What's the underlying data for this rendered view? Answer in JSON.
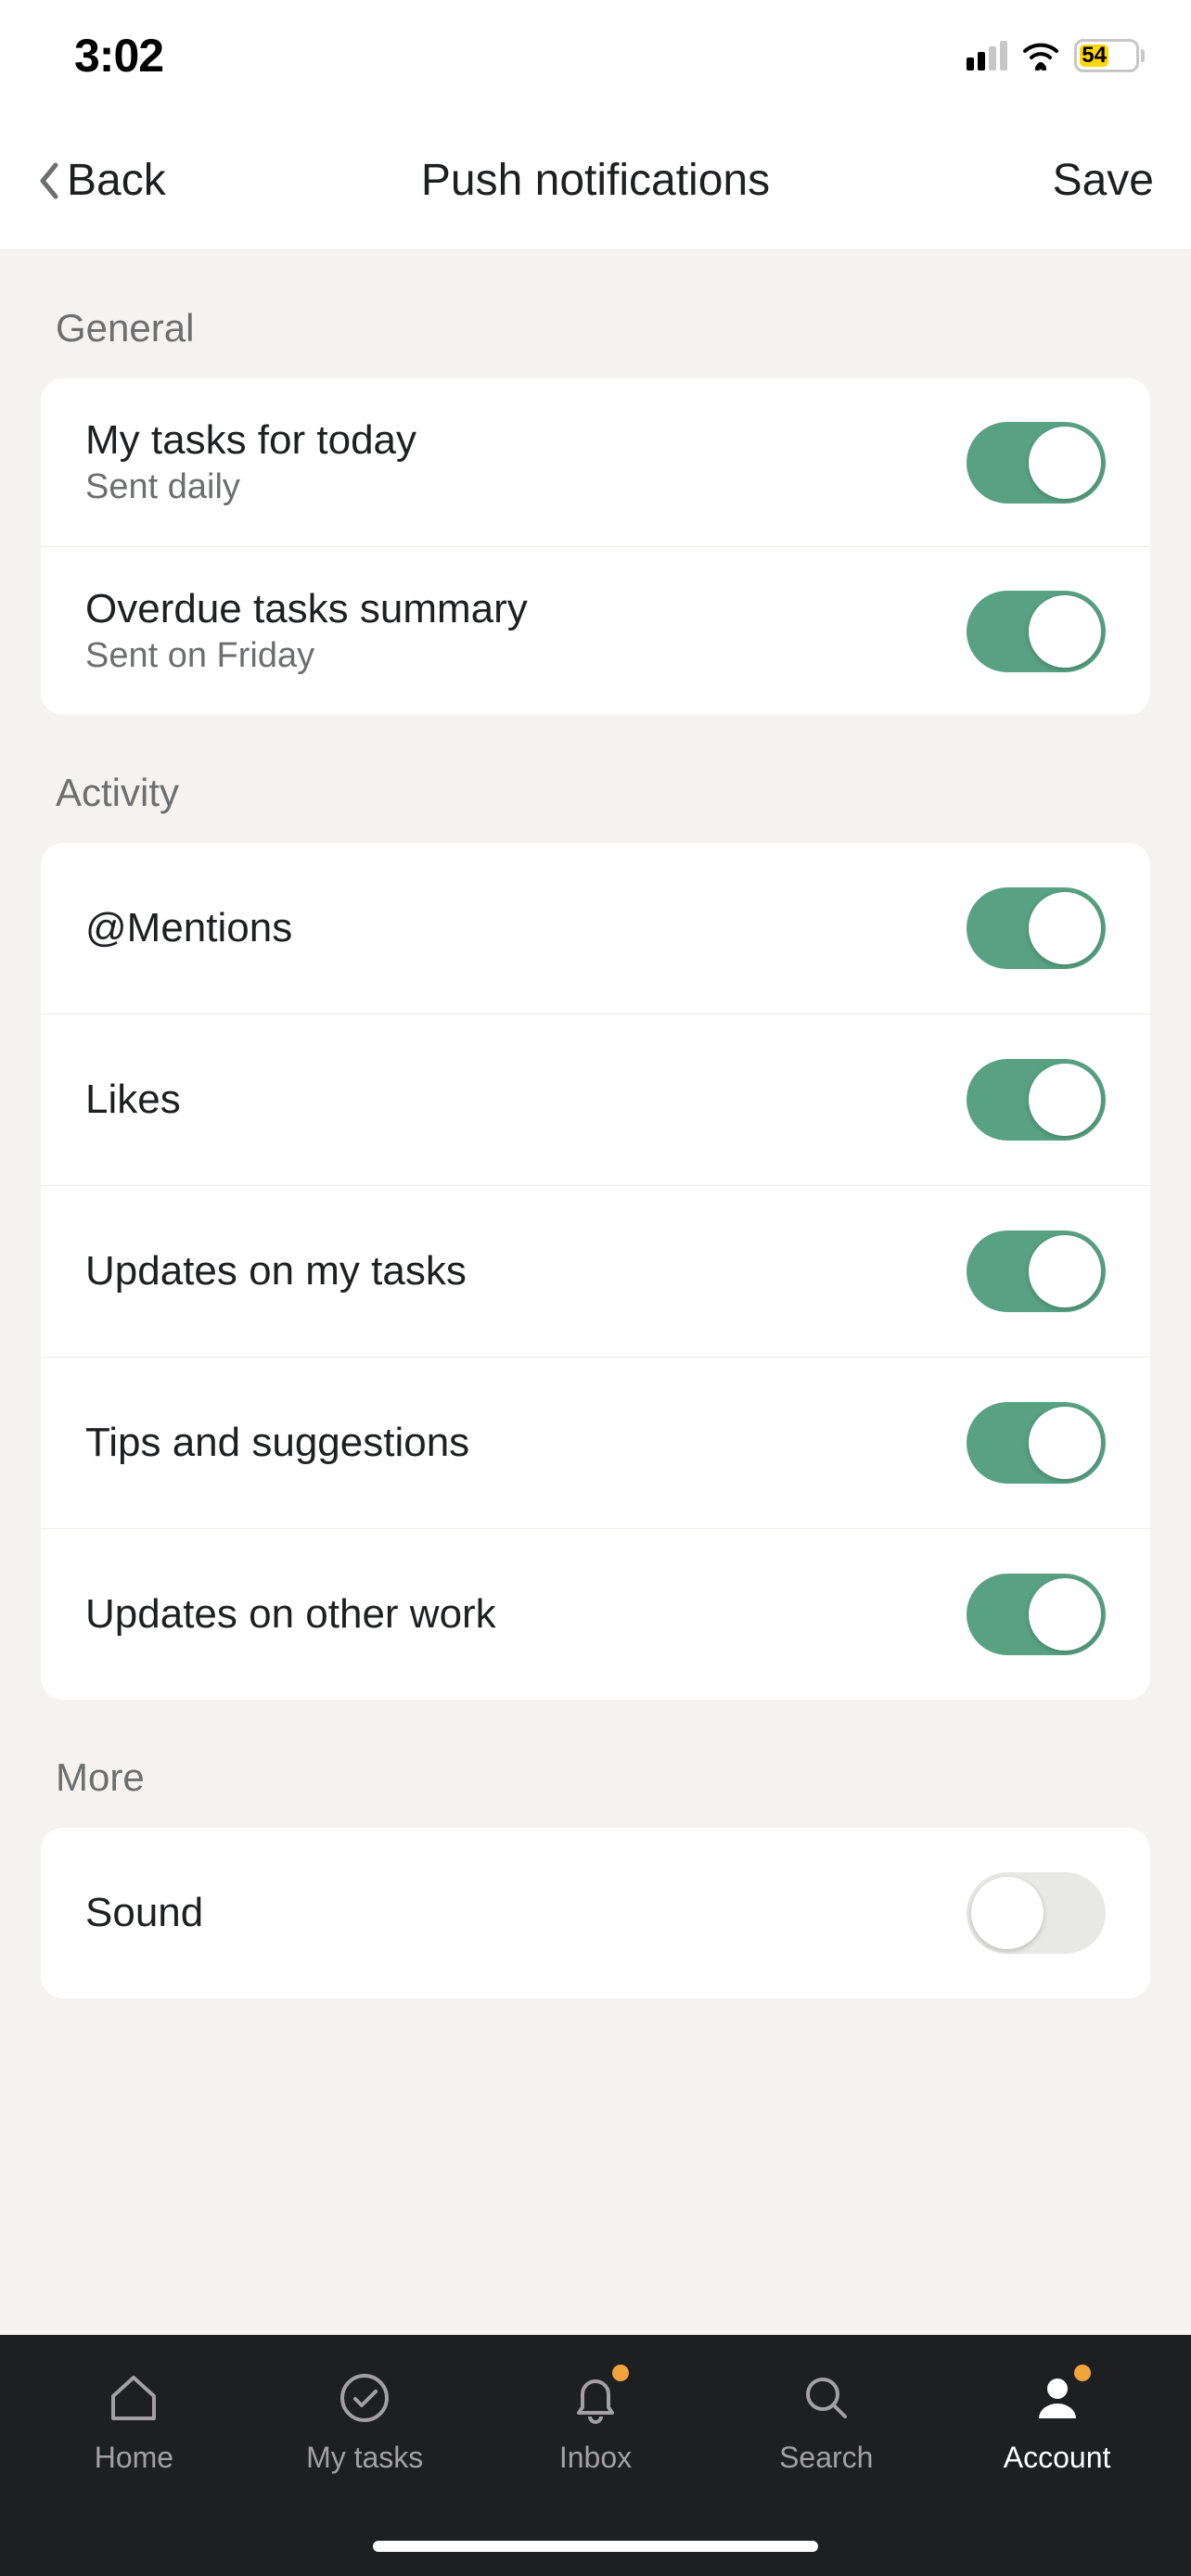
{
  "status": {
    "time": "3:02",
    "battery_pct": "54"
  },
  "nav": {
    "back": "Back",
    "title": "Push notifications",
    "save": "Save"
  },
  "sections": {
    "general": {
      "header": "General",
      "items": [
        {
          "title": "My tasks for today",
          "sub": "Sent daily",
          "on": true
        },
        {
          "title": "Overdue tasks summary",
          "sub": "Sent on Friday",
          "on": true
        }
      ]
    },
    "activity": {
      "header": "Activity",
      "items": [
        {
          "title": "@Mentions",
          "on": true
        },
        {
          "title": "Likes",
          "on": true
        },
        {
          "title": "Updates on my tasks",
          "on": true
        },
        {
          "title": "Tips and suggestions",
          "on": true
        },
        {
          "title": "Updates on other work",
          "on": true
        }
      ]
    },
    "more": {
      "header": "More",
      "items": [
        {
          "title": "Sound",
          "on": false
        }
      ]
    }
  },
  "tabs": [
    {
      "label": "Home",
      "active": false,
      "badge": false
    },
    {
      "label": "My tasks",
      "active": false,
      "badge": false
    },
    {
      "label": "Inbox",
      "active": false,
      "badge": true
    },
    {
      "label": "Search",
      "active": false,
      "badge": false
    },
    {
      "label": "Account",
      "active": true,
      "badge": true
    }
  ]
}
